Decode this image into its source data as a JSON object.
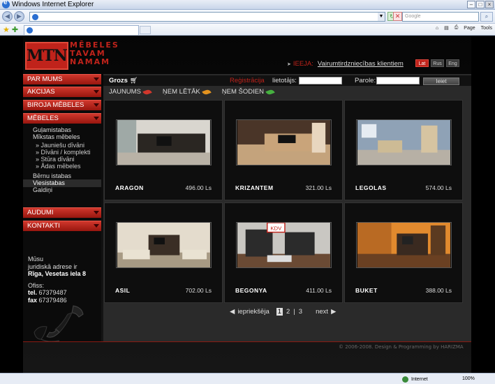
{
  "browser": {
    "title": "Windows Internet Explorer",
    "search_placeholder": "Google",
    "tools": [
      "Page",
      "Tools"
    ],
    "status_zone": "Internet",
    "zoom": "100%"
  },
  "site": {
    "logo_text": "MTN",
    "tagline": [
      "MĒBELES",
      "TAVAM",
      "NAMAM"
    ],
    "login_label": "IEEJA:",
    "wholesale_link": "Vairumtirdzniecības klientiem",
    "languages": [
      {
        "label": "Lat",
        "active": true
      },
      {
        "label": "Rus",
        "active": false
      },
      {
        "label": "Eng",
        "active": false
      }
    ]
  },
  "sidebar": {
    "menu": [
      "PAR MUMS",
      "AKCIJAS",
      "BIROJA MĒBELES",
      "MĒBELES",
      "AUDUMI",
      "KONTAKTI"
    ],
    "sub": [
      "Guļamistabas",
      "Mīkstas mēbeles"
    ],
    "subsub": [
      "» Jauniešu dīvāni",
      "» Dīvāni / komplekti",
      "» Stūra dīvāni",
      "» Ādas mēbeles"
    ],
    "sub2": [
      "Bērnu istabas",
      "Viesistabas",
      "Galdiņi"
    ],
    "address": {
      "line1": "Mūsu",
      "line2": "juridiskā adrese ir",
      "line3": "Rīga, Vesetas iela 8",
      "office": "Ofiss:",
      "tel_label": "tel.",
      "tel": "67379487",
      "fax_label": "fax",
      "fax": "67379486"
    }
  },
  "topbar": {
    "cart": "Grozs",
    "register": "Reģistrācija",
    "user_label": "lietotājs:",
    "password_label": "Parole:",
    "login_button": "Ieiet"
  },
  "filters": [
    {
      "label": "JAUNUMS",
      "color": "#d0372c"
    },
    {
      "label": "ŅEM LĒTĀK",
      "color": "#e3931f"
    },
    {
      "label": "ŅEM ŠODIEN",
      "color": "#46b040"
    }
  ],
  "products": [
    {
      "name": "ARAGON",
      "price": "496.00 Ls"
    },
    {
      "name": "KRIZANTEM",
      "price": "321.00 Ls"
    },
    {
      "name": "LEGOLAS",
      "price": "574.00 Ls"
    },
    {
      "name": "ASIL",
      "price": "702.00 Ls"
    },
    {
      "name": "BEGONYA",
      "price": "411.00 Ls"
    },
    {
      "name": "BUKET",
      "price": "388.00 Ls"
    }
  ],
  "kdv_badge": "KDV",
  "pager": {
    "prev": "iepriekšēja",
    "pages": [
      "1",
      "2",
      "3"
    ],
    "current": "1",
    "next": "next"
  },
  "footer": "© 2006-2008. Design & Programming by HARIZMA",
  "colors": {
    "accent": "#c0231b",
    "bg": "#000000"
  }
}
